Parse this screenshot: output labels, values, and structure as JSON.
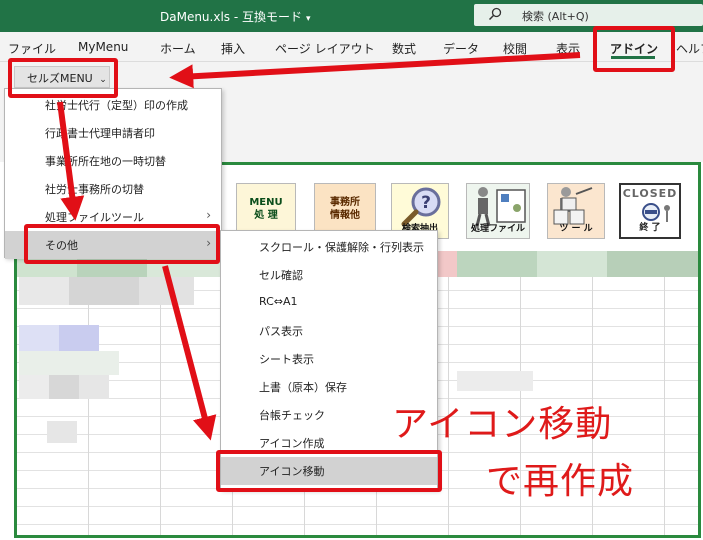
{
  "window": {
    "title": "DaMenu.xls - 互換モード",
    "search_label": "検索 (Alt+Q)"
  },
  "ribbon_tabs": [
    "ファイル",
    "MyMenu",
    "ホーム",
    "挿入",
    "ページ レイアウト",
    "数式",
    "データ",
    "校閲",
    "表示",
    "アドイン",
    "ヘルプ"
  ],
  "cell_menu_button": "セルズMENU",
  "menu_items": [
    "社労士代行（定型）印の作成",
    "行政書士代理申請者印",
    "事業所所在地の一時切替",
    "社労士事務所の切替",
    "処理ファイルツール",
    "その他"
  ],
  "submenu_items": [
    "スクロール・保護解除・行列表示",
    "セル確認",
    "RC⇔A1",
    "パス表示",
    "シート表示",
    "上書（原本）保存",
    "台帳チェック",
    "アイコン作成",
    "アイコン移動"
  ],
  "toolbar": {
    "menu_btn_line1": "MENU",
    "menu_btn_line2": "処 理",
    "office_btn_line1": "事務所",
    "office_btn_line2": "情報他",
    "search_extract_label": "検索抽出",
    "process_file_label": "処理ファイル",
    "tool_label": "ツ ー ル",
    "closed_title": "CLOSED",
    "closed_label": "終 了"
  },
  "annotation": {
    "line1": "アイコン移動",
    "line2": "で再作成"
  },
  "colors": {
    "excel_green": "#217346",
    "highlight_red": "#e10f17",
    "annotation_red": "#df1a1a"
  }
}
